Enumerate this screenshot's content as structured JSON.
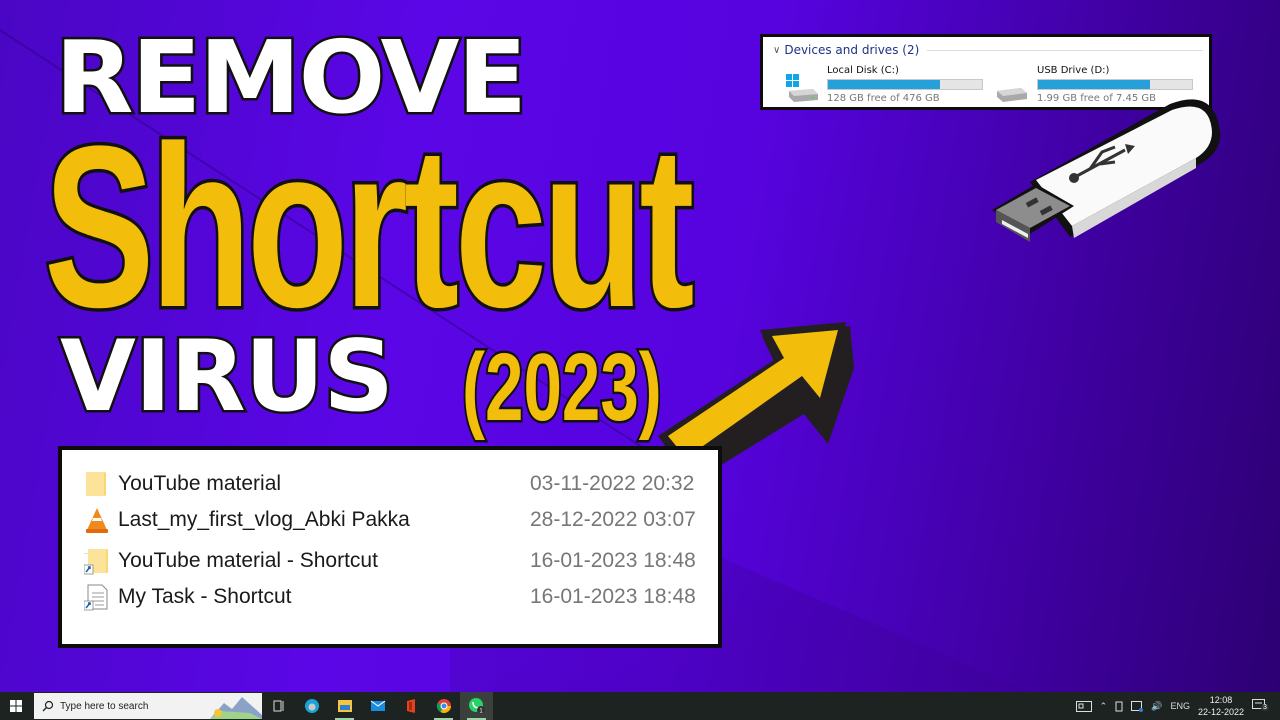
{
  "headline": {
    "line1": "REMOVE",
    "line2": "Shortcut",
    "line3": "VIRUS",
    "year": "(2023)"
  },
  "colors": {
    "accent_yellow": "#f2bd0b",
    "background_purple": "#5703e0",
    "progress_blue": "#26a0da",
    "taskbar": "#1c2320"
  },
  "drives_panel": {
    "section_title": "Devices and drives (2)",
    "drives": [
      {
        "name": "Local Disk (C:)",
        "free_text": "128 GB free of 476 GB",
        "used_fraction": 0.73,
        "icon": "windows-drive-icon"
      },
      {
        "name": "USB Drive (D:)",
        "free_text": "1.99 GB free of 7.45 GB",
        "used_fraction": 0.73,
        "icon": "usb-drive-icon"
      }
    ]
  },
  "files_panel": {
    "files": [
      {
        "name": "YouTube material",
        "date": "03-11-2022 20:32",
        "icon": "folder-icon"
      },
      {
        "name": "Last_my_first_vlog_Abki Pakka",
        "date": "28-12-2022 03:07",
        "icon": "vlc-icon"
      },
      {
        "name": "YouTube material - Shortcut",
        "date": "16-01-2023 18:48",
        "icon": "folder-shortcut-icon"
      },
      {
        "name": "My Task - Shortcut",
        "date": "16-01-2023 18:48",
        "icon": "document-shortcut-icon"
      }
    ]
  },
  "taskbar": {
    "search_placeholder": "Type here to search",
    "apps": [
      "task-view",
      "edge",
      "file-explorer",
      "mail",
      "office",
      "chrome",
      "whatsapp"
    ],
    "whatsapp_badge": "1",
    "language": "ENG",
    "time": "12:08",
    "date": "22-12-2022",
    "notification_count": "3"
  }
}
